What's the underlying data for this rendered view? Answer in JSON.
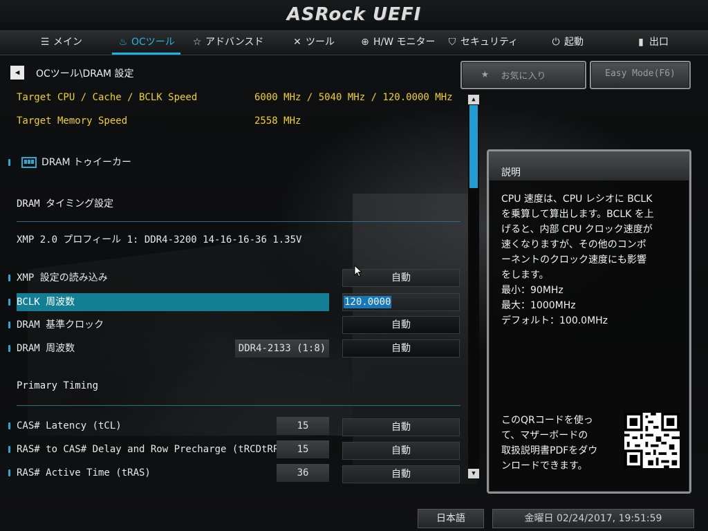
{
  "header": {
    "logo": "ASRock UEFI"
  },
  "nav": [
    {
      "label": "メイン",
      "icon": "list-icon"
    },
    {
      "label": "OCツール",
      "icon": "flame-icon"
    },
    {
      "label": "アドバンスド",
      "icon": "star-icon"
    },
    {
      "label": "ツール",
      "icon": "wrench-icon"
    },
    {
      "label": "H/W モニター",
      "icon": "crosshair-icon"
    },
    {
      "label": "セキュリティ",
      "icon": "shield-icon"
    },
    {
      "label": "起動",
      "icon": "power-icon"
    },
    {
      "label": "出口",
      "icon": "exit-door-icon"
    }
  ],
  "active_tab": "OCツール",
  "breadcrumb": "OCツール\\DRAM 設定",
  "buttons": {
    "favorites": "お気に入り",
    "easy_mode": "Easy Mode(F6)"
  },
  "targets": [
    {
      "label": "Target CPU / Cache / BCLK Speed",
      "value": "6000 MHz / 5040 MHz / 120.0000 MHz"
    },
    {
      "label": "Target Memory Speed",
      "value": "2558 MHz"
    }
  ],
  "dram_tweaker": "DRAM トゥイーカー",
  "timing_section": "DRAM タイミング設定",
  "xmp_profile": "XMP 2.0 プロフィール 1: DDR4-3200 14-16-16-36 1.35V",
  "settings": {
    "xmp_load": {
      "label": "XMP 設定の読み込み",
      "value": "自動"
    },
    "bclk": {
      "label": "BCLK 周波数",
      "value": "120.0000"
    },
    "dram_ref_clock": {
      "label": "DRAM 基準クロック",
      "value": "自動"
    },
    "dram_freq": {
      "label": "DRAM 周波数",
      "current": "DDR4-2133 (1:8)",
      "value": "自動"
    }
  },
  "primary_section": "Primary Timing",
  "timings": [
    {
      "label": "CAS# Latency (tCL)",
      "current": "15",
      "value": "自動"
    },
    {
      "label": "RAS# to CAS# Delay and Row Precharge (tRCDtRP)",
      "current": "15",
      "value": "自動"
    },
    {
      "label": "RAS# Active Time (tRAS)",
      "current": "36",
      "value": "自動"
    }
  ],
  "description": {
    "title": "説明",
    "body": "CPU 速度は、CPU レシオに BCLK\nを乗算して算出します。BCLK を上\nげると、内部 CPU クロック速度が\n速くなりますが、その他のコンポ\nーネントのクロック速度にも影響\nをします。\n最小：90MHz\n最大：1000MHz\nデフォルト：100.0MHz",
    "qr_text": "このQRコードを使っ\nて、マザーボードの\n取扱説明書PDFをダウ\nンロードできます。"
  },
  "footer": {
    "language": "日本語",
    "datetime": "金曜日 02/24/2017, 19:51:59"
  },
  "colors": {
    "accent": "#19b3e6",
    "highlight": "#137f95",
    "target_text": "#f2d21a"
  }
}
